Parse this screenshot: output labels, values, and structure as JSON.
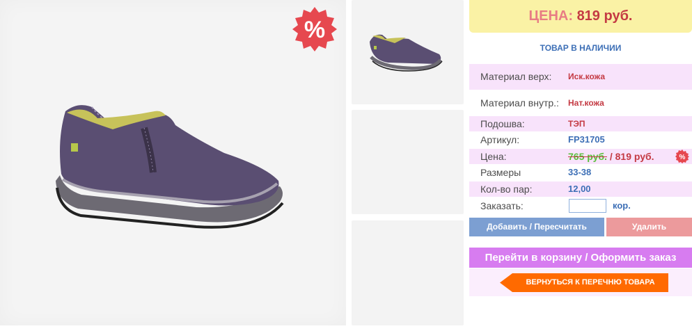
{
  "product": {
    "sale_badge_glyph": "%",
    "sale_badge_color": "#e6484f"
  },
  "price_box": {
    "label": "ЦЕНА:",
    "value": "819 руб."
  },
  "stock_status": "ТОВАР В НАЛИЧИИ",
  "specs": {
    "material_top": {
      "label": "Материал верх:",
      "value": "Иск.кожа"
    },
    "material_inner": {
      "label": "Материал внутр.:",
      "value": "Нат.кожа"
    },
    "sole": {
      "label": "Подошва:",
      "value": "ТЭП"
    },
    "article": {
      "label": "Артикул:",
      "value": "FP31705"
    },
    "price": {
      "label": "Цена:",
      "old_value": "765 руб.",
      "separator": " / ",
      "new_value": "819 руб.",
      "badge_glyph": "%"
    },
    "sizes": {
      "label": "Размеры",
      "value": "33-38"
    },
    "pairs": {
      "label": "Кол-во пар:",
      "value": "12,00"
    },
    "order": {
      "label": "Заказать:",
      "value": "",
      "unit": "кор."
    }
  },
  "buttons": {
    "add": "Добавить / Пересчитать",
    "delete": "Удалить",
    "cart": "Перейти в корзину / Оформить заказ",
    "back": "ВЕРНУТЬСЯ К ПЕРЕЧНЮ ТОВАРА"
  },
  "colors": {
    "accent_blue": "#3d6fb6",
    "accent_red": "#c43a43",
    "cart_purple": "#d77cf0",
    "back_orange": "#ff6a00"
  }
}
